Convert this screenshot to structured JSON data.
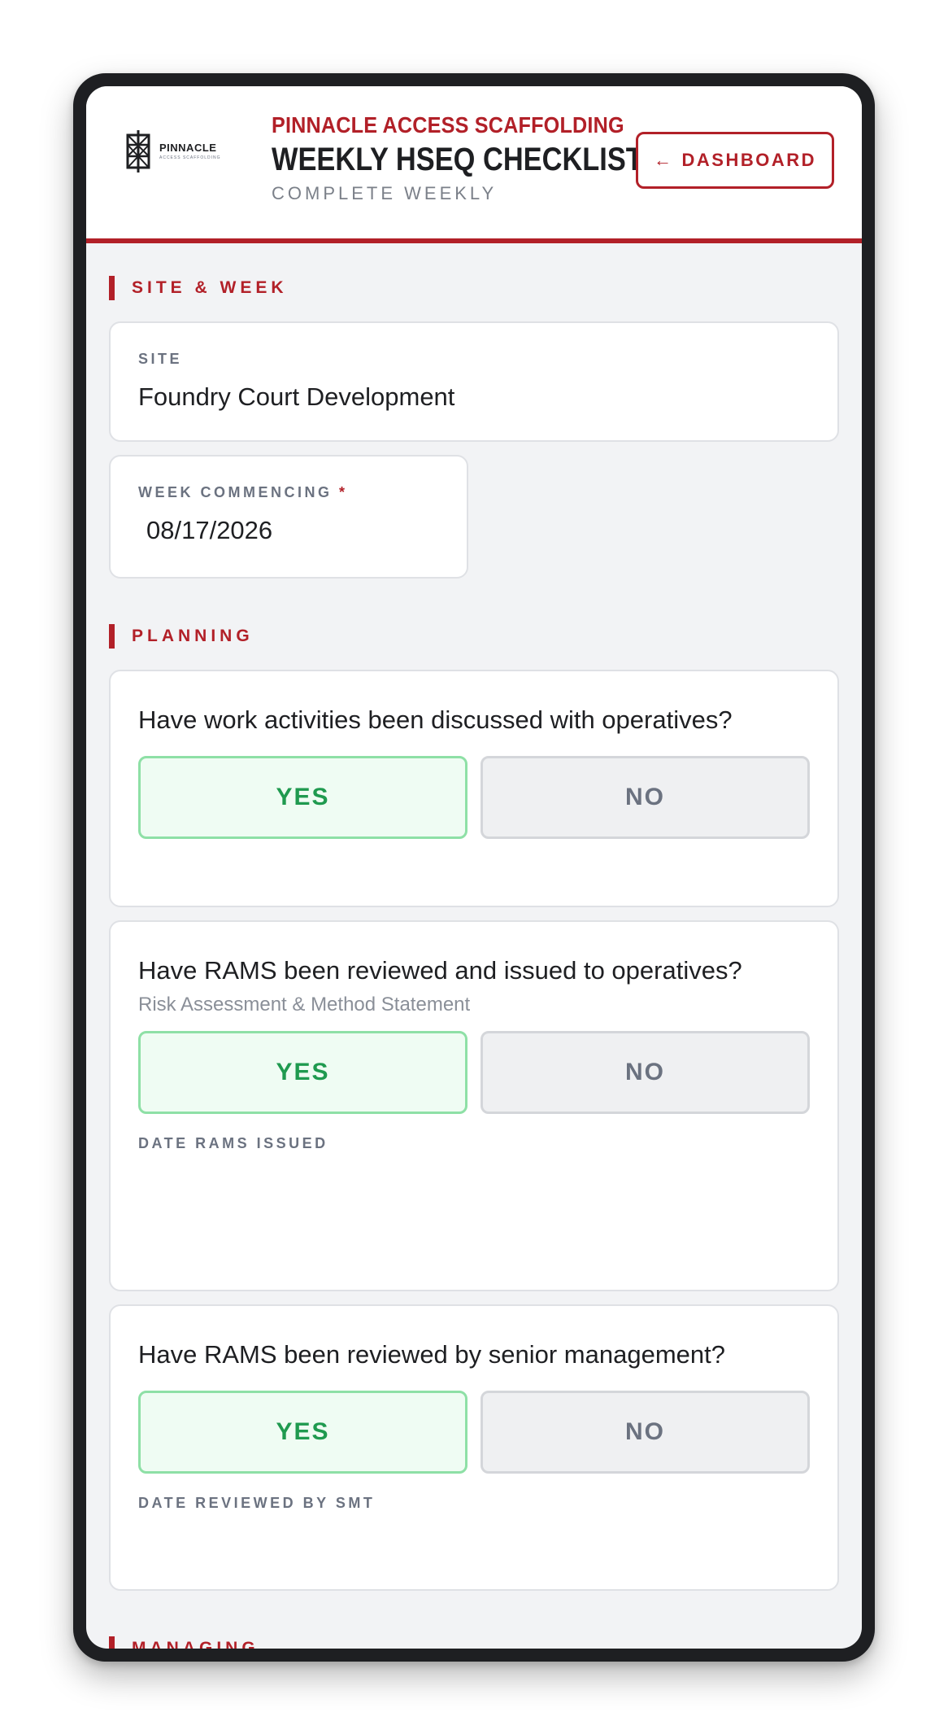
{
  "header": {
    "logo_name": "PINNACLE",
    "logo_sub": "ACCESS SCAFFOLDING",
    "company": "PINNACLE ACCESS SCAFFOLDING",
    "title": "WEEKLY HSEQ CHECKLIST",
    "subtitle": "COMPLETE WEEKLY",
    "dashboard_button": "DASHBOARD",
    "dashboard_arrow": "←"
  },
  "site_week": {
    "section_title": "SITE & WEEK",
    "site_label": "SITE",
    "site_value": "Foundry Court Development",
    "week_label": "WEEK COMMENCING",
    "required_mark": "*",
    "week_value": "08/17/2026"
  },
  "planning": {
    "section_title": "PLANNING",
    "questions": [
      {
        "text": "Have work activities been discussed with operatives?",
        "yes": "YES",
        "no": "NO",
        "selected": "YES"
      },
      {
        "text": "Have RAMS been reviewed and issued to operatives?",
        "hint": "Risk Assessment & Method Statement",
        "yes": "YES",
        "no": "NO",
        "selected": "YES",
        "date_label": "DATE RAMS ISSUED"
      },
      {
        "text": "Have RAMS been reviewed by senior management?",
        "yes": "YES",
        "no": "NO",
        "selected": "YES",
        "date_label": "DATE REVIEWED BY SMT"
      }
    ]
  },
  "managing": {
    "section_title": "MANAGING"
  },
  "colors": {
    "brand_red": "#b22028",
    "yes_green": "#1f9a4f",
    "background": "#f2f3f5"
  }
}
